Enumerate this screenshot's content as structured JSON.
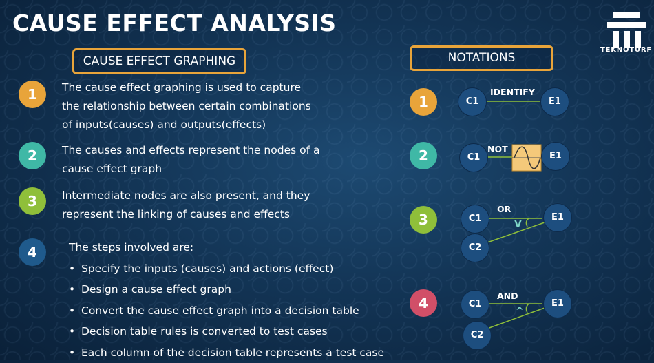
{
  "title": "CAUSE EFFECT ANALYSIS",
  "logo": {
    "text": "TEKNOTURF"
  },
  "left": {
    "heading": "CAUSE EFFECT GRAPHING",
    "points": [
      {
        "num": "1",
        "color": "#e8a43a",
        "lines": [
          "The cause effect graphing is used to capture",
          "the relationship between certain combinations",
          "of inputs(causes) and outputs(effects)"
        ]
      },
      {
        "num": "2",
        "color": "#3fb8a6",
        "lines": [
          "The causes and effects represent the nodes of a",
          "cause effect graph"
        ]
      },
      {
        "num": "3",
        "color": "#8fbf3a",
        "lines": [
          "Intermediate nodes are also present, and they",
          "represent the linking of causes and effects"
        ]
      },
      {
        "num": "4",
        "color": "#1f5a8c",
        "intro": "The steps involved are:"
      }
    ],
    "steps": [
      "Specify the inputs (causes) and actions (effect)",
      "Design a cause effect graph",
      "Convert the cause effect graph into a decision table",
      "Decision table rules is converted to test cases",
      "Each column of the decision table represents a test case"
    ]
  },
  "right": {
    "heading": "NOTATIONS",
    "items": [
      {
        "num": "1",
        "color": "#e8a43a",
        "label": "IDENTIFY",
        "c1": "C1",
        "e1": "E1"
      },
      {
        "num": "2",
        "color": "#3fb8a6",
        "label": "NOT",
        "c1": "C1",
        "e1": "E1"
      },
      {
        "num": "3",
        "color": "#8fbf3a",
        "label": "OR",
        "c1": "C1",
        "c2": "C2",
        "e1": "E1",
        "symbol": "V"
      },
      {
        "num": "4",
        "color": "#d14f68",
        "label": "AND",
        "c1": "C1",
        "c2": "C2",
        "e1": "E1",
        "symbol": "^"
      }
    ]
  }
}
